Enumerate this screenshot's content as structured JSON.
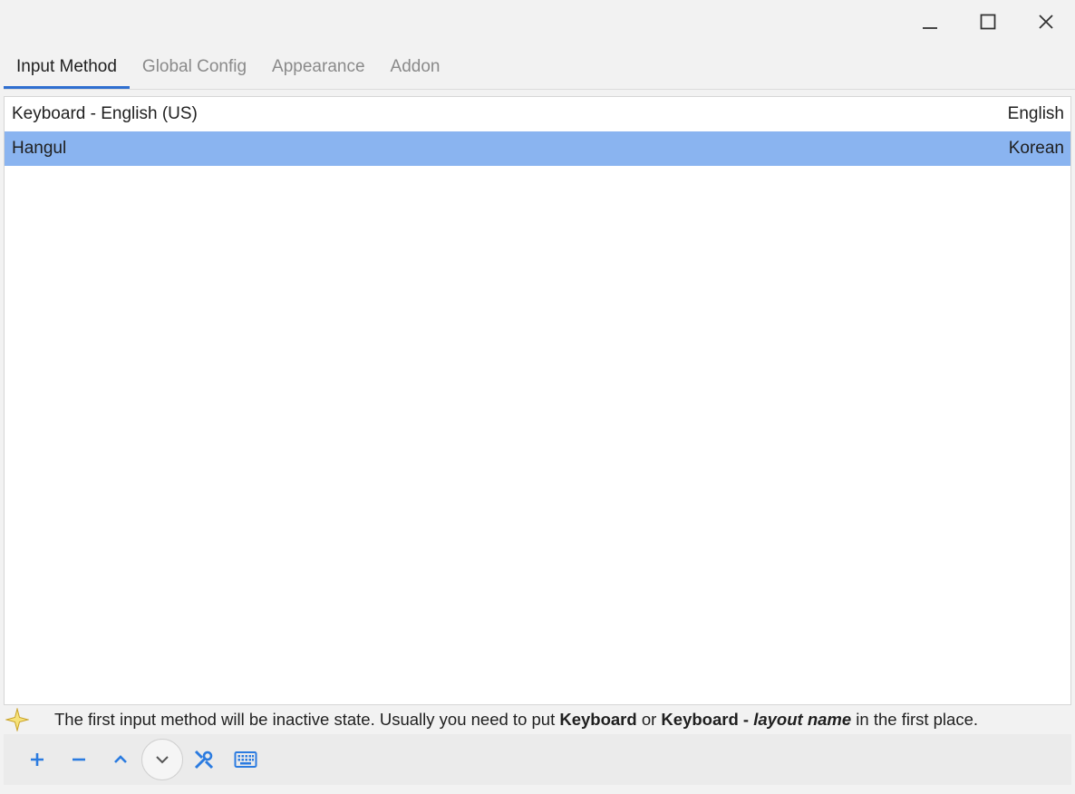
{
  "window": {
    "controls": {
      "minimize": "_",
      "maximize": "□",
      "close": "×"
    }
  },
  "tabs": [
    {
      "label": "Input Method",
      "active": true
    },
    {
      "label": "Global Config",
      "active": false
    },
    {
      "label": "Appearance",
      "active": false
    },
    {
      "label": "Addon",
      "active": false
    }
  ],
  "input_methods": [
    {
      "name": "Keyboard - English (US)",
      "language": "English",
      "selected": false
    },
    {
      "name": "Hangul",
      "language": "Korean",
      "selected": true
    }
  ],
  "hint": {
    "icon": "star-icon",
    "prefix": "The first input method will be inactive state. Usually you need to put ",
    "bold1": "Keyboard",
    "middle": " or ",
    "bold2": "Keyboard - ",
    "bold_italic": "layout name",
    "suffix": " in the first place."
  },
  "toolbar": {
    "buttons": [
      {
        "name": "add-icon"
      },
      {
        "name": "remove-icon"
      },
      {
        "name": "move-up-icon"
      },
      {
        "name": "move-down-icon"
      },
      {
        "name": "configure-icon"
      },
      {
        "name": "keyboard-layout-icon"
      }
    ]
  },
  "colors": {
    "accent": "#2f6fd0",
    "selection": "#8ab4f0",
    "icon_blue": "#2b7be0"
  }
}
